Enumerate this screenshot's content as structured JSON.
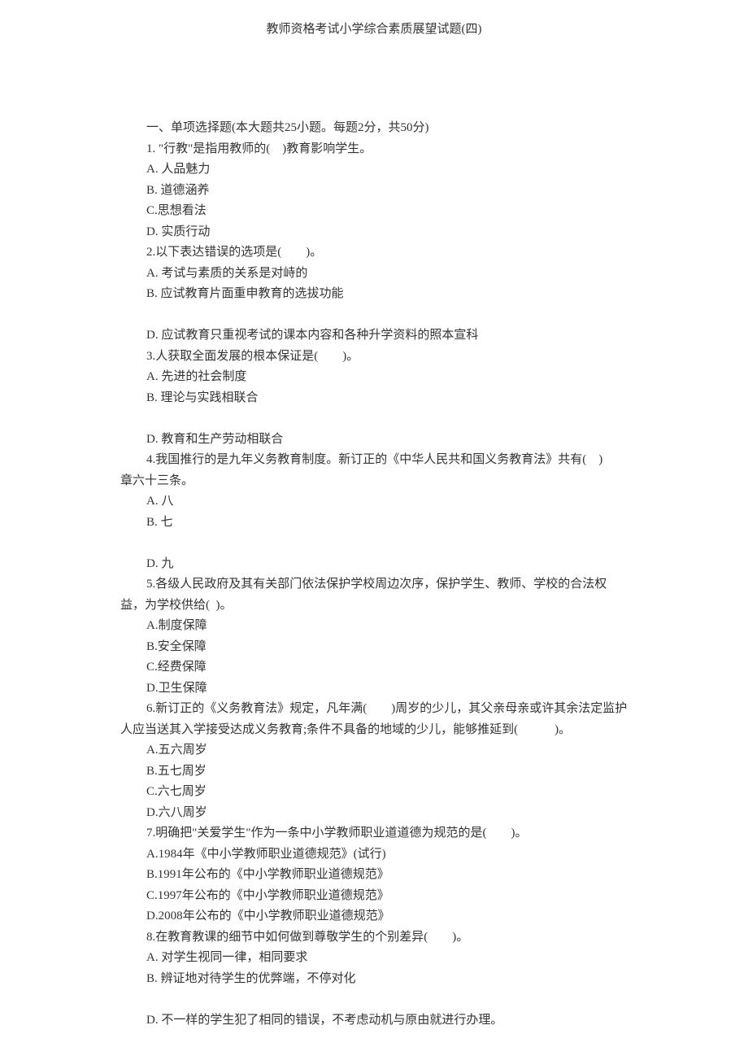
{
  "title": "教师资格考试小学综合素质展望试题(四)",
  "sectionHeader": "一、单项选择题(本大题共25小题。每题2分，共50分)",
  "q1": {
    "stem": "1. \"行教\"是指用教师的(　)教育影响学生。",
    "a": "A. 人品魅力",
    "b": "B. 道德涵养",
    "c": "C.思想看法",
    "d": "D. 实质行动"
  },
  "q2": {
    "stem": "2.以下表达错误的选项是(　　)。",
    "a": "A. 考试与素质的关系是对峙的",
    "b": "B. 应试教育片面重申教育的选拔功能",
    "d": "D. 应试教育只重视考试的课本内容和各种升学资料的照本宣科"
  },
  "q3": {
    "stem": "3.人获取全面发展的根本保证是(　　)。",
    "a": "A. 先进的社会制度",
    "b": "B. 理论与实践相联合",
    "d": "D. 教育和生产劳动相联合"
  },
  "q4": {
    "stem1": "4.我国推行的是九年义务教育制度。新订正的《中华人民共和国义务教育法》共有(　)",
    "stem2": "章六十三条。",
    "a": "A. 八",
    "b": "B. 七",
    "d": "D. 九"
  },
  "q5": {
    "stem1": "5.各级人民政府及其有关部门依法保护学校周边次序，保护学生、教师、学校的合法权",
    "stem2": "益，为学校供给(  )。",
    "a": "A.制度保障",
    "b": "B.安全保障",
    "c": "C.经费保障",
    "d": "D.卫生保障"
  },
  "q6": {
    "stem1": "6.新订正的《义务教育法》规定，凡年满(　　)周岁的少儿，其父亲母亲或许其余法定监护",
    "stem2": "人应当送其入学接受达成义务教育;条件不具备的地域的少儿，能够推延到(　　　)。",
    "a": "A.五六周岁",
    "b": "B.五七周岁",
    "c": "C.六七周岁",
    "d": "D.六八周岁"
  },
  "q7": {
    "stem": "7.明确把\"关爱学生\"作为一条中小学教师职业道道德为规范的是(　　)。",
    "a": "A.1984年《中小学教师职业道德规范》(试行)",
    "b": "B.1991年公布的《中小学教师职业道德规范》",
    "c": "C.1997年公布的《中小学教师职业道德规范》",
    "d": "D.2008年公布的《中小学教师职业道德规范》"
  },
  "q8": {
    "stem": "8.在教育教课的细节中如何做到尊敬学生的个别差异(　　)。",
    "a": "A. 对学生视同一律，相同要求",
    "b": "B. 辨证地对待学生的优弊端，不停对化",
    "d": "D. 不一样的学生犯了相同的错误，不考虑动机与原由就进行办理。"
  }
}
